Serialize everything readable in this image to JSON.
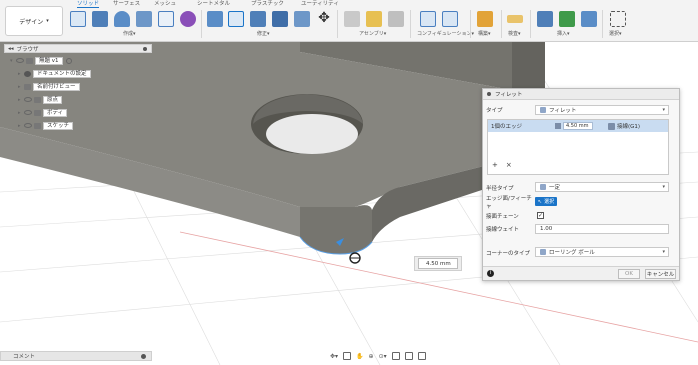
{
  "toolbar": {
    "design_label": "デザイン",
    "tabs": [
      "ソリッド",
      "サーフェス",
      "メッシュ",
      "シートメタル",
      "プラスチック",
      "ユーティリティ"
    ],
    "groups": [
      "作成▾",
      "修正▾",
      "アセンブリ▾",
      "コンフィギュレーション▾",
      "構築▾",
      "検査▾",
      "挿入▾",
      "選択▾"
    ]
  },
  "browser": {
    "title": "ブラウザ",
    "root": "無題 v1",
    "items": [
      "ドキュメントの設定",
      "名前付けビュー",
      "原点",
      "ボディ",
      "スケッチ"
    ]
  },
  "fillet": {
    "title": "フィレット",
    "type_label": "タイプ",
    "type_value": "フィレット",
    "edge_label": "1個のエッジ",
    "edge_radius": "4.50 mm",
    "edge_continuity": "接線(G1)",
    "add_label": "+",
    "remove_label": "×",
    "radius_type_label": "半径タイプ",
    "radius_type_value": "一定",
    "tangent_label": "エッジ面/フィーチャ",
    "select_label": "選択",
    "tangent_chain_label": "接面チェーン",
    "tangent_weight_label": "接線ウェイト",
    "tangent_weight_value": "1.00",
    "corner_label": "コーナーのタイプ",
    "corner_value": "ローリング ボール",
    "ok": "OK",
    "cancel": "キャンセル"
  },
  "radius_input": "4.50 mm",
  "comments_label": "コメント",
  "colors": {
    "accent": "#1a74c8",
    "body_top": "#85847e",
    "body_side": "#6e6d67",
    "edge_highlight": "#c9dcf1"
  }
}
